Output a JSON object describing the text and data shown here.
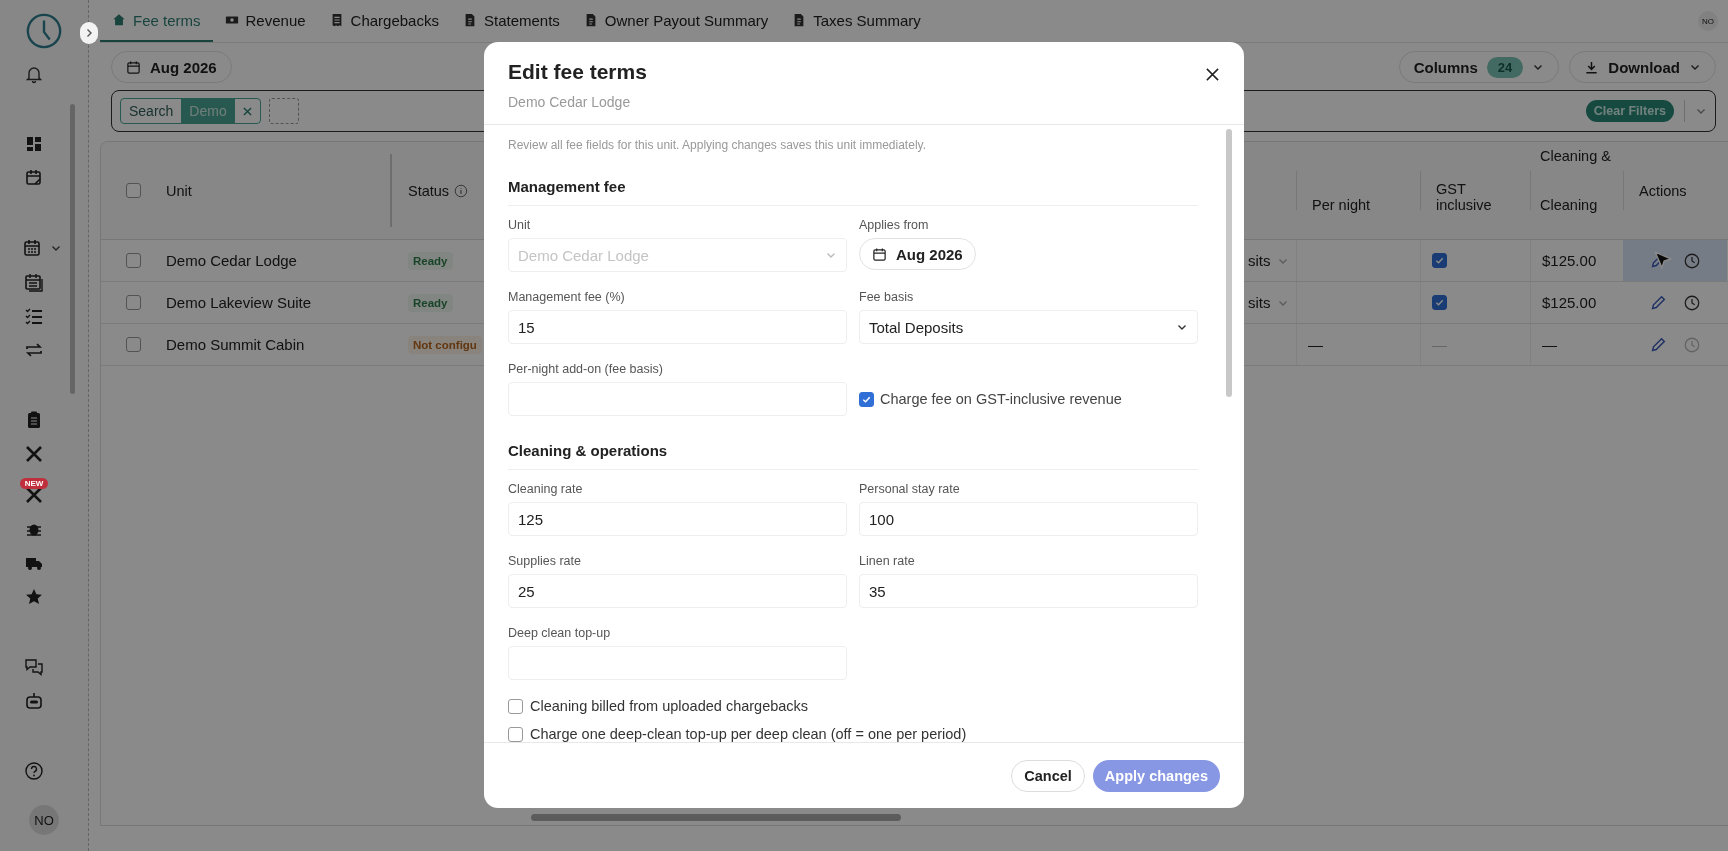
{
  "sidebar": {
    "badge": "NEW",
    "avatar": "NO"
  },
  "tabs": [
    {
      "label": "Fee terms",
      "selected": true
    },
    {
      "label": "Revenue",
      "selected": false
    },
    {
      "label": "Chargebacks",
      "selected": false
    },
    {
      "label": "Statements",
      "selected": false
    },
    {
      "label": "Owner Payout Summary",
      "selected": false
    },
    {
      "label": "Taxes Summary",
      "selected": false
    }
  ],
  "user_avatar": "NO",
  "toolbar": {
    "period": "Aug 2026",
    "columns_label": "Columns",
    "columns_count": "24",
    "download": "Download"
  },
  "filters": {
    "field": "Search",
    "value": "Demo",
    "clear": "Clear Filters"
  },
  "table": {
    "select_all": false,
    "group_header": "Cleaning &",
    "columns": [
      "Unit",
      "Status",
      "Per night",
      "GST inclusive",
      "Cleaning",
      "Actions"
    ],
    "rows": [
      {
        "selected": false,
        "unit": "Demo Cedar Lodge",
        "status": {
          "text": "Ready",
          "kind": "ready"
        },
        "basis": "sits",
        "gst_checked": true,
        "cleaning": "$125.00",
        "highlighted": true,
        "history_enabled": true
      },
      {
        "selected": false,
        "unit": "Demo Lakeview Suite",
        "status": {
          "text": "Ready",
          "kind": "ready"
        },
        "basis": "sits",
        "gst_checked": true,
        "cleaning": "$125.00",
        "highlighted": false,
        "history_enabled": true
      },
      {
        "selected": false,
        "unit": "Demo Summit Cabin",
        "status": {
          "text": "Not configu",
          "kind": "warning"
        },
        "per_night": "—",
        "gst_text": "—",
        "cleaning": "—",
        "highlighted": false,
        "history_enabled": false
      }
    ]
  },
  "modal": {
    "title": "Edit fee terms",
    "subtitle": "Demo Cedar Lodge",
    "intro": "Review all fee fields for this unit. Applying changes saves this unit immediately.",
    "sections": [
      {
        "title": "Management fee",
        "fields": [
          {
            "kind": "select",
            "label": "Unit",
            "value": "Demo Cedar Lodge",
            "disabled": true
          },
          {
            "kind": "date",
            "label": "Applies from",
            "value": "Aug 2026"
          },
          {
            "kind": "text",
            "label": "Management fee (%)",
            "value": "15"
          },
          {
            "kind": "select",
            "label": "Fee basis",
            "value": "Total Deposits",
            "disabled": false
          },
          {
            "kind": "text",
            "label": "Per-night add-on (fee basis)"
          },
          {
            "kind": "checkbox",
            "label": "Charge fee on GST-inclusive revenue",
            "checked": true
          }
        ]
      },
      {
        "title": "Cleaning & operations",
        "fields": [
          {
            "kind": "text",
            "label": "Cleaning rate",
            "value": "125"
          },
          {
            "kind": "text",
            "label": "Personal stay rate",
            "value": "100"
          },
          {
            "kind": "text",
            "label": "Supplies rate",
            "value": "25"
          },
          {
            "kind": "text",
            "label": "Linen rate",
            "value": "35"
          },
          {
            "kind": "text",
            "label": "Deep clean top-up"
          },
          {
            "kind": "option",
            "label": "Cleaning billed from uploaded chargebacks",
            "checked": false
          },
          {
            "kind": "option",
            "label": "Charge one deep-clean top-up per deep clean (off = one per period)",
            "checked": false
          }
        ]
      }
    ],
    "cancel": "Cancel",
    "apply": "Apply changes",
    "apply_disabled": true
  }
}
